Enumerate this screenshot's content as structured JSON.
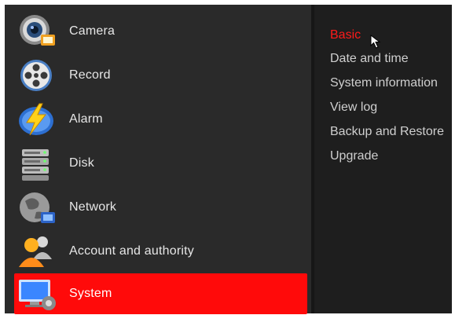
{
  "colors": {
    "accent": "#ff0a0a",
    "panel_bg": "#2a2a2a",
    "submenu_bg": "#1e1e1e",
    "text": "#e6e6e6"
  },
  "menu": {
    "items": [
      {
        "label": "Camera",
        "icon": "camera-icon"
      },
      {
        "label": "Record",
        "icon": "film-reel-icon"
      },
      {
        "label": "Alarm",
        "icon": "lightning-alarm-icon"
      },
      {
        "label": "Disk",
        "icon": "hard-disk-icon"
      },
      {
        "label": "Network",
        "icon": "globe-network-icon"
      },
      {
        "label": "Account and authority",
        "icon": "users-icon"
      },
      {
        "label": "System",
        "icon": "monitor-settings-icon",
        "active": true
      }
    ]
  },
  "submenu": {
    "items": [
      {
        "label": "Basic",
        "active": true
      },
      {
        "label": "Date and time"
      },
      {
        "label": "System information"
      },
      {
        "label": "View log"
      },
      {
        "label": "Backup and Restore"
      },
      {
        "label": "Upgrade"
      }
    ]
  }
}
